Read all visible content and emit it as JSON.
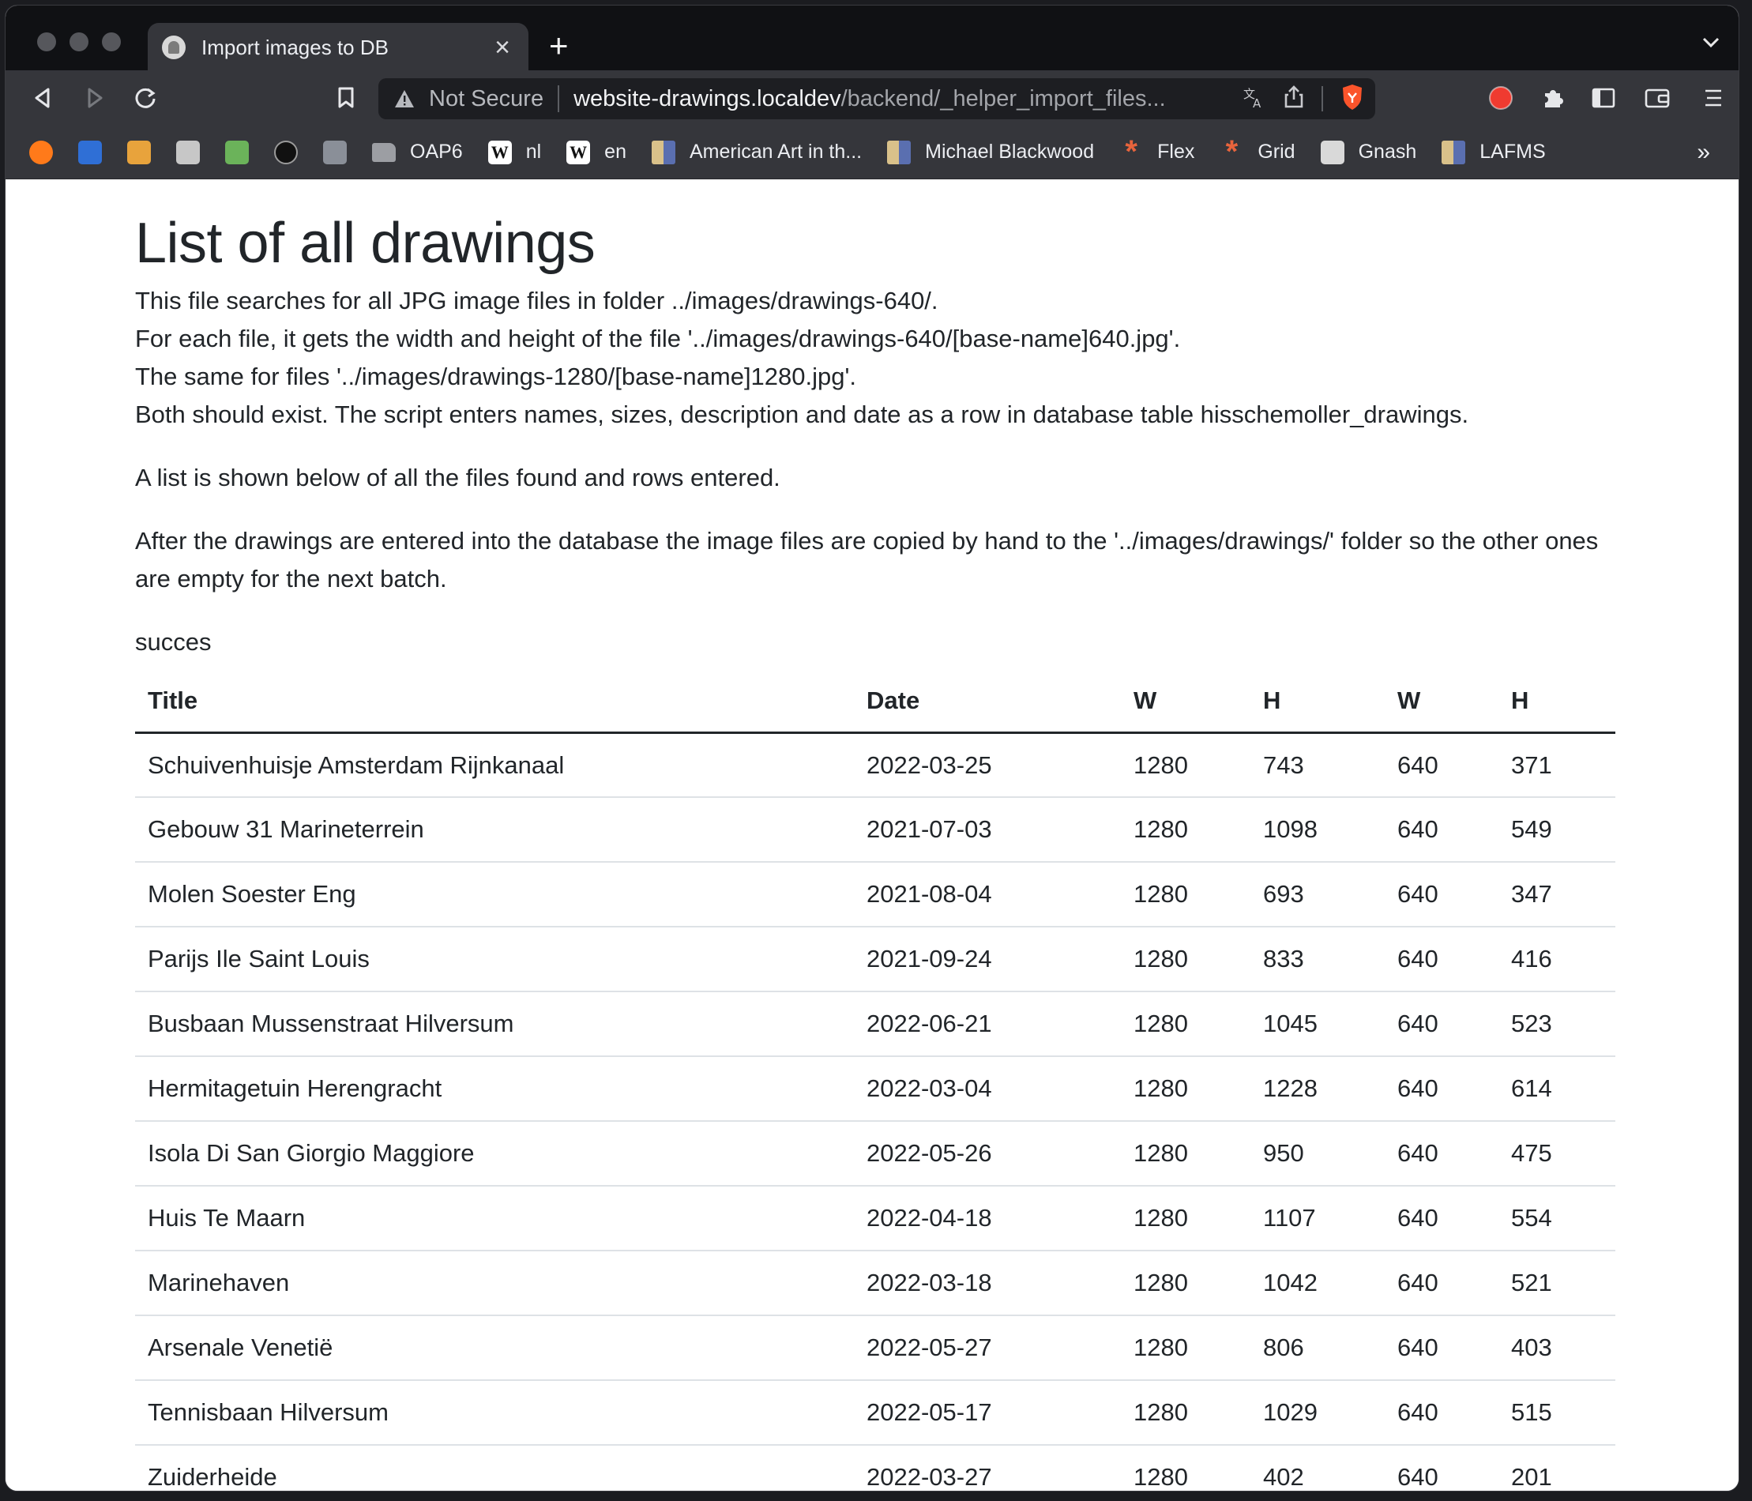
{
  "browser": {
    "tab": {
      "title": "Import images to DB"
    },
    "address": {
      "security_label": "Not Secure",
      "url_host": "website-drawings.localdev",
      "url_path": "/backend/_helper_import_files..."
    },
    "bookmarks": [
      {
        "label": "",
        "icon": "rss-icon",
        "color": "#ff7a1a"
      },
      {
        "label": "",
        "icon": "circle-blue-icon",
        "color": "#2f6fd6"
      },
      {
        "label": "",
        "icon": "rtve-icon",
        "color": "#e8a33c"
      },
      {
        "label": "",
        "icon": "synology-icon",
        "color": "#c7c7c7"
      },
      {
        "label": "",
        "icon": "map-leaf-icon",
        "color": "#6bb35a"
      },
      {
        "label": "",
        "icon": "vinyl-icon",
        "color": "#111111"
      },
      {
        "label": "",
        "icon": "building-icon",
        "color": "#8a8f98"
      },
      {
        "label": "OAP6",
        "icon": "folder-icon",
        "color": "#9c9ea3"
      },
      {
        "label": "nl",
        "icon": "wikipedia-icon",
        "color": "#ffffff"
      },
      {
        "label": "en",
        "icon": "wikipedia-icon",
        "color": "#ffffff"
      },
      {
        "label": "American Art in th...",
        "icon": "tile-icon",
        "color": "#c9b27a"
      },
      {
        "label": "Michael Blackwood",
        "icon": "tile-icon",
        "color": "#c9b27a"
      },
      {
        "label": "Flex",
        "icon": "asterisk-icon",
        "color": "#e8643c"
      },
      {
        "label": "Grid",
        "icon": "asterisk-icon",
        "color": "#e8643c"
      },
      {
        "label": "Gnash",
        "icon": "gnu-icon",
        "color": "#d9d9d9"
      },
      {
        "label": "LAFMS",
        "icon": "tile-icon",
        "color": "#c9b27a"
      }
    ],
    "bookmarks_more": "»",
    "brand_color": "#fb542b"
  },
  "page": {
    "title": "List of all drawings",
    "intro_lines": [
      "This file searches for all JPG image files in folder ../images/drawings-640/.",
      "For each file, it gets the width and height of the file '../images/drawings-640/[base-name]640.jpg'.",
      "The same for files '../images/drawings-1280/[base-name]1280.jpg'.",
      "Both should exist. The script enters names, sizes, description and date as a row in database table hisschemoller_drawings."
    ],
    "list_note": "A list is shown below of all the files found and rows entered.",
    "copy_note": "After the drawings are entered into the database the image files are copied by hand to the '../images/drawings/' folder so the other ones are empty for the next batch.",
    "status": "succes",
    "table": {
      "headers": [
        "Title",
        "Date",
        "W",
        "H",
        "W",
        "H"
      ],
      "rows": [
        [
          "Schuivenhuisje Amsterdam Rijnkanaal",
          "2022-03-25",
          "1280",
          "743",
          "640",
          "371"
        ],
        [
          "Gebouw 31 Marineterrein",
          "2021-07-03",
          "1280",
          "1098",
          "640",
          "549"
        ],
        [
          "Molen Soester Eng",
          "2021-08-04",
          "1280",
          "693",
          "640",
          "347"
        ],
        [
          "Parijs Ile Saint Louis",
          "2021-09-24",
          "1280",
          "833",
          "640",
          "416"
        ],
        [
          "Busbaan Mussenstraat Hilversum",
          "2022-06-21",
          "1280",
          "1045",
          "640",
          "523"
        ],
        [
          "Hermitagetuin Herengracht",
          "2022-03-04",
          "1280",
          "1228",
          "640",
          "614"
        ],
        [
          "Isola Di San Giorgio Maggiore",
          "2022-05-26",
          "1280",
          "950",
          "640",
          "475"
        ],
        [
          "Huis Te Maarn",
          "2022-04-18",
          "1280",
          "1107",
          "640",
          "554"
        ],
        [
          "Marinehaven",
          "2022-03-18",
          "1280",
          "1042",
          "640",
          "521"
        ],
        [
          "Arsenale Venetië",
          "2022-05-27",
          "1280",
          "806",
          "640",
          "403"
        ],
        [
          "Tennisbaan Hilversum",
          "2022-05-17",
          "1280",
          "1029",
          "640",
          "515"
        ],
        [
          "Zuiderheide",
          "2022-03-27",
          "1280",
          "402",
          "640",
          "201"
        ]
      ]
    }
  }
}
